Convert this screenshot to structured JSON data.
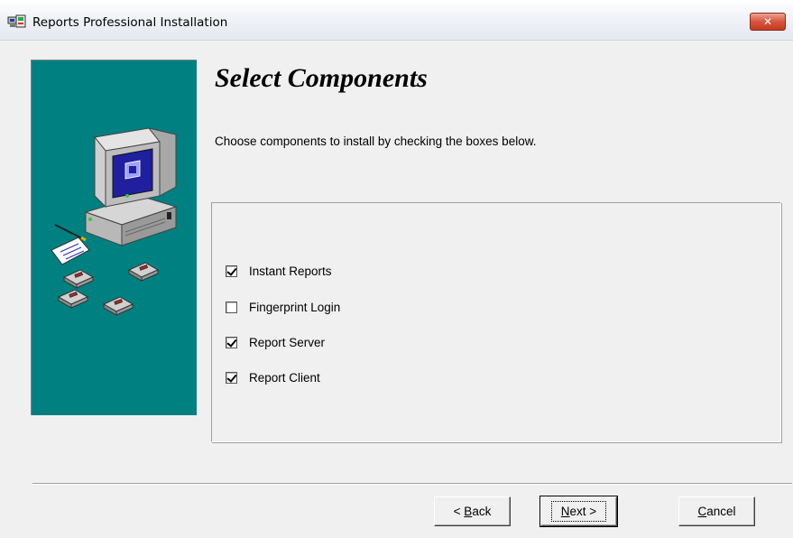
{
  "window": {
    "title": "Reports Professional  Installation",
    "close_glyph": "✕"
  },
  "page": {
    "heading": "Select Components",
    "instructions": "Choose components to install by checking the boxes below."
  },
  "components": [
    {
      "label": "Instant Reports",
      "checked": true
    },
    {
      "label": "Fingerprint Login",
      "checked": false
    },
    {
      "label": "Report Server",
      "checked": true
    },
    {
      "label": "Report Client",
      "checked": true
    }
  ],
  "buttons": {
    "back_prefix": "< ",
    "back_mnemonic": "B",
    "back_rest": "ack",
    "next_mnemonic": "N",
    "next_rest": "ext >",
    "cancel_mnemonic": "C",
    "cancel_rest": "ancel"
  },
  "colors": {
    "side_panel": "#008080",
    "close_button": "#c43a1f",
    "dialog_background": "#f0f0f0"
  },
  "icons": {
    "app": "installer-app-icon",
    "side_art": "computer-with-floppies-illustration"
  }
}
